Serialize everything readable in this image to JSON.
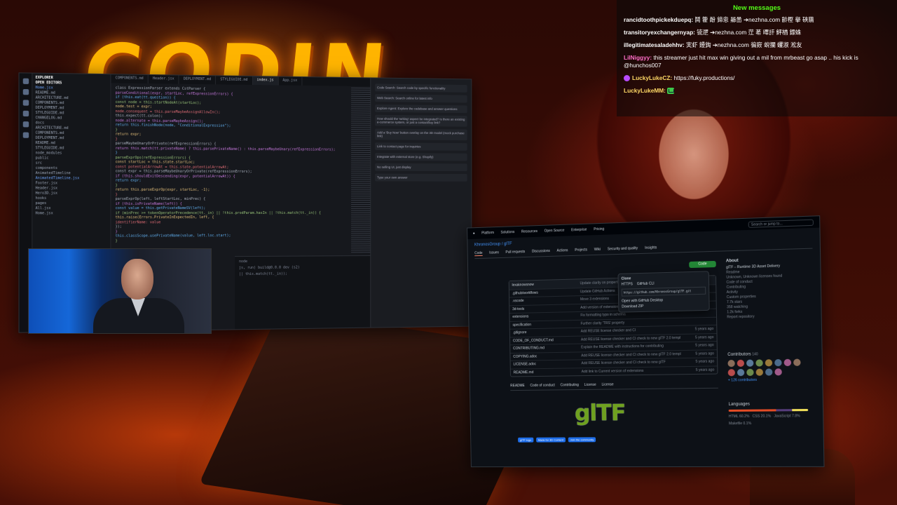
{
  "stream": {
    "banner_text": "CODIN"
  },
  "chat": {
    "title": "New messages",
    "messages": [
      {
        "user": "rancidtoothpickekduepq:",
        "text": "鬨 籗 酚 鍗恖 曏啚 ➔nezhna.com 齡樫 擧 硤藬",
        "color": "#ffffff"
      },
      {
        "user": "transitoryexchangernyap:",
        "text": "锍遻 ➔nezhna.com 茳 莃 曎訐 鮃楢 鏢蛛",
        "color": "#ffffff"
      },
      {
        "user": "illegitimatesaladehhv:",
        "text": "実虾 鑸鋾 ➔nezhna.com 徧窽 蜺攔 蠼淑 淞友",
        "color": "#ffffff"
      },
      {
        "user": "LilNiggyy:",
        "text": "this streamer just hit max win giving out a mil from mrbeast go asap .. his kick is @hunchos007",
        "color": "#ff6ec7"
      },
      {
        "user": "LuckyLukeCZ:",
        "text": "https://fuky.productions/",
        "color": "#ffd966",
        "badge": "subscriber-badge-icon"
      },
      {
        "user": "LuckyLukeMM:",
        "text": "",
        "color": "#ffd966",
        "emote": "gift-emote-icon"
      }
    ]
  },
  "ide": {
    "explorer_title": "EXPLORER",
    "open_editors": "OPEN EDITORS",
    "files": [
      "Home.jsx",
      "README.md",
      "ARCHITECTURE.md",
      "COMPONENTS.md",
      "DEPLOYMENT.md",
      "STYLEGUIDE.md",
      "CHANGELOG.md",
      "docs",
      "ARCHITECTURE.md",
      "COMPONENTS.md",
      "DEPLOYMENT.md",
      "README.md",
      "STYLEGUIDE.md",
      "node_modules",
      "public",
      "src",
      "components",
      "AnimatedTimeline",
      "AnimatedTimeline.jsx",
      "Footer.jsx",
      "Header.jsx",
      "Hero3D.jsx",
      "hooks",
      "pages",
      "All.jsx",
      "Home.jsx"
    ],
    "tabs": [
      "COMPONENTS.md",
      "Header.jsx",
      "DEPLOYMENT.md",
      "STYLEGUIDE.md",
      "index.js",
      "App.jsx"
    ],
    "code_lines": [
      "class ExpressionParser extends CstParser {",
      "  parseConditional(expr, startLoc, refExpressionErrors) {",
      "    if (this.eat(tt.question)) {",
      "      const node = this.startNodeAt(startLoc);",
      "      node.test = expr;",
      "      node.consequent = this.parseMaybeAssignAllowIn();",
      "      this.expect(tt.colon);",
      "      node.alternate = this.parseMaybeAssign();",
      "      return this.finishNode(node, \"ConditionalExpression\");",
      "    }",
      "    return expr;",
      "  }",
      "  parseMaybeUnaryOrPrivate(refExpressionErrors) {",
      "    return this.match(tt.privateName) ? this.parsePrivateName() : this.parseMaybeUnary(refExpressionErrors);",
      "  }",
      "  parseExprOps(refExpressionErrors) {",
      "    const startLoc = this.state.startLoc;",
      "    const potentialArrowAt = this.state.potentialArrowAt;",
      "    const expr = this.parseMaybeUnaryOrPrivate(refExpressionErrors);",
      "    if (this.shouldExitDescending(expr, potentialArrowAt)) {",
      "      return expr;",
      "    }",
      "    return this.parseExprOp(expr, startLoc, -1);",
      "  }",
      "  parseExprOp(left, leftStartLoc, minPrec) {",
      "    if (this.isPrivateName(left)) {",
      "      const value = this.getPrivateNameSV(left);",
      "      if (minPrec >= tokenOperatorPrecedence(tt._in) || !this.prodParam.hasIn || !this.match(tt._in)) {",
      "        this.raise(Errors.PrivateInExpectedIn, left, {",
      "          identifierName: value",
      "        });",
      "      }",
      "      this.classScope.usePrivateName(value, left.loc.start);",
      "    }"
    ],
    "terminal_lines": [
      "node",
      "js, run) build@0.0.0 dev (s2)",
      "|| this.match(tt._in));"
    ],
    "chat_pane": [
      "Code Search: Search code by specific functionality",
      "Web Search: Search online for latest info",
      "Explore Agent: Explore the codebase and answer questions",
      "How should the 'writing' aspect be integrated? Is there an existing e-commerce system, or just a contact/buy link?",
      "Add a 'Buy Now' button overlay on the 3D model (mock purchase link)",
      "Link to contact page for inquiries",
      "Integrate with external store (e.g. Shopify)",
      "No selling UI, just display",
      "Type your own answer"
    ]
  },
  "webcam": {
    "label": "streamer-webcam"
  },
  "github": {
    "nav": [
      "Platform",
      "Solutions",
      "Resources",
      "Open Source",
      "Enterprise",
      "Pricing"
    ],
    "search_placeholder": "Search or jump to...",
    "repo": "KhronosGroup / glTF",
    "repo_tabs": [
      "Code",
      "Issues",
      "Pull requests",
      "Discussions",
      "Actions",
      "Projects",
      "Wiki",
      "Security and quality",
      "Insights"
    ],
    "branch": "main",
    "code_button": "Code",
    "clone_title": "Clone",
    "clone_tabs": [
      "HTTPS",
      "GitHub CLI"
    ],
    "clone_url": "https://github.com/KhronosGroup/glTF.git",
    "clone_open_desktop": "Open with GitHub Desktop",
    "clone_download": "Download ZIP",
    "files": [
      {
        "name": "lexaknowsnow",
        "msg": "Update clarity on properties in 3d modeling",
        "date": ""
      },
      {
        "name": ".github/workflows",
        "msg": "Update GitHub Actions",
        "date": ""
      },
      {
        "name": ".vscode",
        "msg": "Move 3 extensions",
        "date": ""
      },
      {
        "name": "3d-tools",
        "msg": "Add version of extensions",
        "date": ""
      },
      {
        "name": "extensions",
        "msg": "Fix formatting typo in schema",
        "date": ""
      },
      {
        "name": "specification",
        "msg": "Further clarity 'TRS' property",
        "date": ""
      },
      {
        "name": ".gitignore",
        "msg": "Add REUSE license checker and CI",
        "date": "5 years ago"
      },
      {
        "name": "CODE_OF_CONDUCT.md",
        "msg": "Add REUSE license checker and CI check to new glTF 2.0 templ",
        "date": "5 years ago"
      },
      {
        "name": "CONTRIBUTING.md",
        "msg": "Explain the README with instructions for contributing",
        "date": "5 years ago"
      },
      {
        "name": "COPYING.adoc",
        "msg": "Add REUSE license checker and CI check to new glTF 2.0 templ",
        "date": "5 years ago"
      },
      {
        "name": "LICENSE.adoc",
        "msg": "Add REUSE license checker and CI check to new glTF",
        "date": "5 years ago"
      },
      {
        "name": "README.md",
        "msg": "Add link to Current version of extensions",
        "date": "5 years ago"
      }
    ],
    "readme_tabs": [
      "README",
      "Code of conduct",
      "Contributing",
      "License",
      "License"
    ],
    "logo_text": "glTF",
    "badges": [
      "glTF logo",
      "Made for 3D Content",
      "Join the community"
    ],
    "about_title": "About",
    "about_desc": "glTF – Runtime 3D Asset Delivery",
    "about_items": [
      "Readme",
      "Unknown, Unknown licenses found",
      "Code of conduct",
      "Contributing",
      "Activity",
      "Custom properties",
      "7.7k stars",
      "358 watching",
      "1.2k forks",
      "Report repository"
    ],
    "contributors_title": "Contributors",
    "contributors_count": "140",
    "contributors_more": "+ 126 contributors",
    "languages_title": "Languages",
    "languages": [
      "HTML 60.2%",
      "CSS 20.1%",
      "JavaScript 7.8%",
      "Makefile 0.1%"
    ]
  }
}
